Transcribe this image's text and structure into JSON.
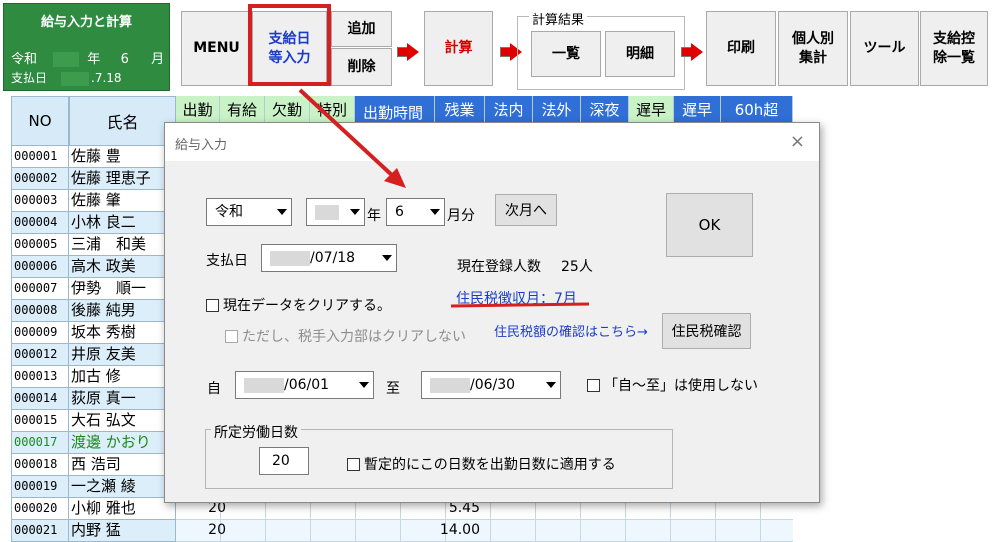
{
  "info": {
    "title": "給与入力と計算",
    "era": "令和",
    "year_suffix": "年",
    "month": "6",
    "month_suffix": "月",
    "pay_label": "支払日",
    "pay_date": ".7.18"
  },
  "ribbon": {
    "menu": "MENU",
    "pay_input": "支給日\n等入力",
    "add": "追加",
    "delete": "削除",
    "calc": "計算",
    "group_label": "計算結果",
    "list": "一覧",
    "detail": "明細",
    "print": "印刷",
    "per_person": "個人別\n集計",
    "tools": "ツール",
    "deduction": "支給控\n除一覧"
  },
  "sheet": {
    "col_no": "NO",
    "col_name": "氏名",
    "headers": [
      "出勤",
      "有給",
      "欠勤",
      "特別",
      "出勤時間",
      "残業",
      "法内",
      "法外",
      "深夜",
      "遅早",
      "遅早",
      "60h超"
    ],
    "rows": [
      {
        "no": "000001",
        "name": "佐藤 豊"
      },
      {
        "no": "000002",
        "name": "佐藤 理恵子"
      },
      {
        "no": "000003",
        "name": "佐藤 肇"
      },
      {
        "no": "000004",
        "name": "小林 良二"
      },
      {
        "no": "000005",
        "name": "三浦　和美"
      },
      {
        "no": "000006",
        "name": "高木 政美"
      },
      {
        "no": "000007",
        "name": "伊勢　順一"
      },
      {
        "no": "000008",
        "name": "後藤 純男"
      },
      {
        "no": "000009",
        "name": "坂本 秀樹"
      },
      {
        "no": "000012",
        "name": "井原 友美"
      },
      {
        "no": "000013",
        "name": "加古 修"
      },
      {
        "no": "000014",
        "name": "荻原 真一"
      },
      {
        "no": "000015",
        "name": "大石 弘文"
      },
      {
        "no": "000017",
        "name": "渡邊 かおり"
      },
      {
        "no": "000018",
        "name": "西 浩司"
      },
      {
        "no": "000019",
        "name": "一之瀬 綾"
      },
      {
        "no": "000020",
        "name": "小柳 雅也",
        "days": "20",
        "overtime": "5.45"
      },
      {
        "no": "000021",
        "name": "内野 猛",
        "days": "20",
        "overtime": "14.00"
      }
    ]
  },
  "dialog": {
    "title": "給与入力",
    "close": "×",
    "era_select": "令和",
    "year_suffix": "年",
    "month_select": "6",
    "month_suffix": "月分",
    "next_month": "次月へ",
    "ok": "OK",
    "pay_label": "支払日",
    "pay_date": "/07/18",
    "registered_label": "現在登録人数",
    "registered_count": "25人",
    "resident_tax_month": "住民税徴収月：7月",
    "clear_data": "現在データをクリアする。",
    "clear_note": "ただし、税手入力部はクリアしない",
    "tax_link": "住民税額の確認はこちら→",
    "tax_button": "住民税確認",
    "from_label": "自",
    "from_date": "/06/01",
    "to_label": "至",
    "to_date": "/06/30",
    "no_range": "「自～至」は使用しない",
    "work_days_label": "所定労働日数",
    "work_days": "20",
    "apply_days": "暫定的にこの日数を出勤日数に適用する"
  },
  "colors": {
    "accent_red": "#d42020",
    "info_green": "#2e8b3f",
    "header_green": "#c9f2c6",
    "header_blue": "#2f6fd6",
    "link_blue": "#1a3cc8"
  }
}
